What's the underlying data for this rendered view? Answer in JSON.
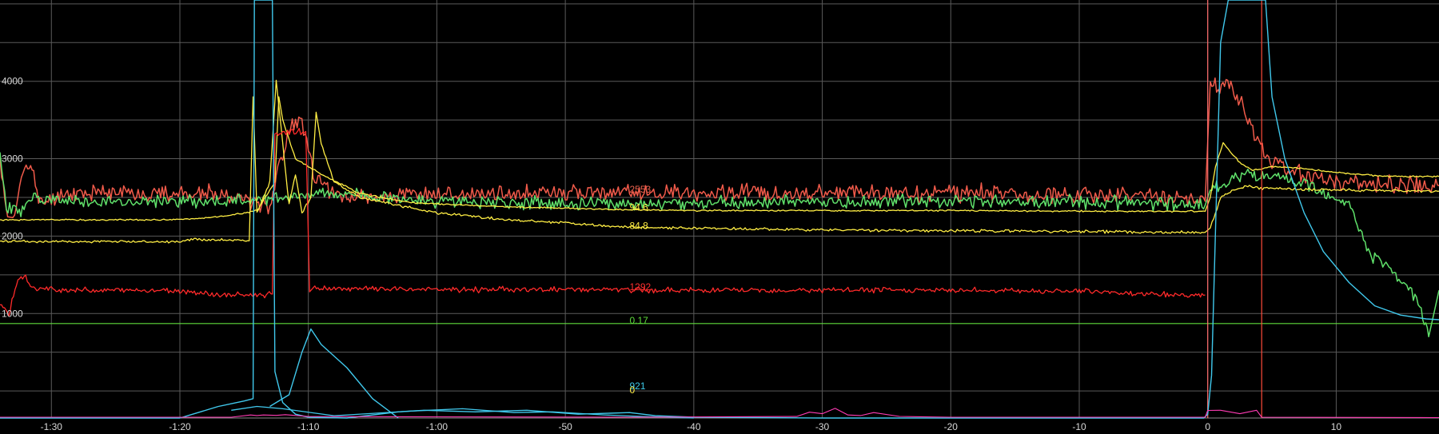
{
  "chart_data": {
    "type": "line",
    "title": "",
    "xlabel": "",
    "ylabel": "",
    "grid": true,
    "background": "#000000",
    "grid_color": "#5a5a5a",
    "xlim": [
      -94,
      18
    ],
    "ylim": [
      -350,
      5050
    ],
    "x_ticks": [
      {
        "value": -90,
        "label": "-1:30"
      },
      {
        "value": -80,
        "label": "-1:20"
      },
      {
        "value": -70,
        "label": "-1:10"
      },
      {
        "value": -60,
        "label": "-1:00"
      },
      {
        "value": -50,
        "label": "-50"
      },
      {
        "value": -40,
        "label": "-40"
      },
      {
        "value": -30,
        "label": "-30"
      },
      {
        "value": -20,
        "label": "-20"
      },
      {
        "value": -10,
        "label": "-10"
      },
      {
        "value": 0,
        "label": "0"
      },
      {
        "value": 10,
        "label": "10"
      }
    ],
    "y_ticks": [
      {
        "value": 1000,
        "label": "1000"
      },
      {
        "value": 2000,
        "label": "2000"
      },
      {
        "value": 3000,
        "label": "3000"
      },
      {
        "value": 4000,
        "label": "4000"
      }
    ],
    "cursor": {
      "x": -45,
      "labels": [
        {
          "text": "2553",
          "color": "#e8604c",
          "y": 2560
        },
        {
          "text": "94.6",
          "color": "#ffee44",
          "y": 2330
        },
        {
          "text": "84.8",
          "color": "#ffee44",
          "y": 2090
        },
        {
          "text": "1292",
          "color": "#ff3030",
          "y": 1300
        },
        {
          "text": "0.17",
          "color": "#5fdc3c",
          "y": 870
        },
        {
          "text": "921",
          "color": "#3cc8e8",
          "y": 20
        },
        {
          "text": "0",
          "color": "#ffee44",
          "y": -30
        }
      ]
    },
    "series": [
      {
        "color": "#f05a4a",
        "jitter": 90,
        "width": 1.5,
        "seed": 11,
        "points": [
          [
            -94,
            2950
          ],
          [
            -93.4,
            2250
          ],
          [
            -93,
            2150
          ],
          [
            -92.2,
            2850
          ],
          [
            -91.5,
            2950
          ],
          [
            -91,
            2400
          ],
          [
            -89,
            2560
          ],
          [
            -82,
            2560
          ],
          [
            -77,
            2540
          ],
          [
            -74,
            2450
          ],
          [
            -73,
            2400
          ],
          [
            -71.5,
            3400
          ],
          [
            -70.5,
            3500
          ],
          [
            -69.5,
            2700
          ],
          [
            -67,
            2500
          ],
          [
            -60,
            2540
          ],
          [
            -50,
            2560
          ],
          [
            -40,
            2560
          ],
          [
            -30,
            2560
          ],
          [
            -20,
            2560
          ],
          [
            -10,
            2540
          ],
          [
            -4,
            2500
          ],
          [
            -0.2,
            2450
          ],
          [
            0.2,
            3950
          ],
          [
            1.8,
            3950
          ],
          [
            3,
            3600
          ],
          [
            4,
            3200
          ],
          [
            5,
            3000
          ],
          [
            7,
            2800
          ],
          [
            10,
            2700
          ],
          [
            18,
            2650
          ]
        ]
      },
      {
        "color": "#5fe06a",
        "jitter": 70,
        "width": 1.5,
        "seed": 23,
        "points": [
          [
            -94,
            3000
          ],
          [
            -93.5,
            2400
          ],
          [
            -92.5,
            2300
          ],
          [
            -91.5,
            2500
          ],
          [
            -90,
            2450
          ],
          [
            -82,
            2450
          ],
          [
            -77,
            2450
          ],
          [
            -72,
            2500
          ],
          [
            -70,
            2550
          ],
          [
            -67,
            2550
          ],
          [
            -60,
            2450
          ],
          [
            -50,
            2420
          ],
          [
            -40,
            2420
          ],
          [
            -30,
            2450
          ],
          [
            -20,
            2460
          ],
          [
            -10,
            2450
          ],
          [
            -4,
            2420
          ],
          [
            -0.2,
            2400
          ],
          [
            0.2,
            2600
          ],
          [
            3,
            2800
          ],
          [
            5,
            2750
          ],
          [
            8,
            2650
          ],
          [
            11,
            2400
          ],
          [
            12.5,
            1800
          ],
          [
            14,
            1600
          ],
          [
            15.5,
            1350
          ],
          [
            16.5,
            1100
          ],
          [
            17.2,
            700
          ],
          [
            17.6,
            1000
          ],
          [
            18,
            1300
          ]
        ]
      },
      {
        "color": "#ffee44",
        "jitter": 8,
        "width": 1.3,
        "seed": 31,
        "points": [
          [
            -94,
            2210
          ],
          [
            -90,
            2210
          ],
          [
            -82,
            2210
          ],
          [
            -79,
            2220
          ],
          [
            -76,
            2270
          ],
          [
            -74,
            2330
          ],
          [
            -72.6,
            2700
          ],
          [
            -72.3,
            3800
          ],
          [
            -72,
            3500
          ],
          [
            -71,
            3000
          ],
          [
            -69,
            2800
          ],
          [
            -66,
            2550
          ],
          [
            -62,
            2430
          ],
          [
            -55,
            2380
          ],
          [
            -50,
            2360
          ],
          [
            -45,
            2340
          ],
          [
            -40,
            2330
          ],
          [
            -20,
            2330
          ],
          [
            -5,
            2320
          ],
          [
            -0.2,
            2320
          ],
          [
            0.2,
            2500
          ],
          [
            0.6,
            2900
          ],
          [
            1.2,
            3200
          ],
          [
            2.5,
            2950
          ],
          [
            3.5,
            2850
          ],
          [
            5,
            2900
          ],
          [
            7,
            2880
          ],
          [
            10,
            2820
          ],
          [
            14,
            2770
          ],
          [
            18,
            2770
          ]
        ]
      },
      {
        "color": "#ffee44",
        "jitter": 14,
        "width": 1.3,
        "seed": 37,
        "points": [
          [
            -94,
            1930
          ],
          [
            -86,
            1930
          ],
          [
            -80,
            1930
          ],
          [
            -79,
            1960
          ],
          [
            -76,
            1950
          ],
          [
            -74.6,
            1940
          ],
          [
            -74.3,
            3800
          ],
          [
            -74,
            2300
          ],
          [
            -73,
            2700
          ],
          [
            -72.5,
            4000
          ],
          [
            -72,
            3200
          ],
          [
            -71.5,
            2400
          ],
          [
            -71,
            2800
          ],
          [
            -70.5,
            2300
          ],
          [
            -69.8,
            2500
          ],
          [
            -69.4,
            3600
          ],
          [
            -69,
            3200
          ],
          [
            -68,
            2700
          ],
          [
            -66,
            2500
          ],
          [
            -60,
            2300
          ],
          [
            -55,
            2220
          ],
          [
            -50,
            2170
          ],
          [
            -45,
            2110
          ],
          [
            -40,
            2100
          ],
          [
            -30,
            2080
          ],
          [
            -20,
            2070
          ],
          [
            -10,
            2060
          ],
          [
            -4,
            2050
          ],
          [
            -0.2,
            2050
          ],
          [
            0.2,
            2100
          ],
          [
            1,
            2500
          ],
          [
            2,
            2600
          ],
          [
            3,
            2650
          ],
          [
            4,
            2620
          ],
          [
            8,
            2600
          ],
          [
            18,
            2580
          ]
        ]
      },
      {
        "color": "#ff2a2a",
        "jitter": 30,
        "width": 1.3,
        "seed": 43,
        "points": [
          [
            -94,
            1100
          ],
          [
            -93.3,
            1000
          ],
          [
            -92.6,
            1450
          ],
          [
            -92,
            1470
          ],
          [
            -91.5,
            1330
          ],
          [
            -90,
            1310
          ],
          [
            -85,
            1300
          ],
          [
            -80,
            1300
          ],
          [
            -77,
            1240
          ],
          [
            -74,
            1240
          ],
          [
            -72.8,
            1250
          ],
          [
            -72.6,
            3300
          ],
          [
            -72,
            3350
          ],
          [
            -70.2,
            3350
          ],
          [
            -69.9,
            1280
          ],
          [
            -69.5,
            1320
          ],
          [
            -60,
            1310
          ],
          [
            -50,
            1310
          ],
          [
            -40,
            1300
          ],
          [
            -30,
            1300
          ],
          [
            -20,
            1300
          ],
          [
            -10,
            1290
          ],
          [
            -5,
            1250
          ],
          [
            -0.2,
            1240
          ]
        ]
      },
      {
        "color": "#5fdc3c",
        "jitter": 0,
        "width": 1.2,
        "seed": 0,
        "points": [
          [
            -94,
            870
          ],
          [
            18,
            870
          ]
        ]
      },
      {
        "color": "#ff6b6b",
        "jitter": 0,
        "width": 1.2,
        "seed": 0,
        "points": [
          [
            0,
            -350
          ],
          [
            0,
            5050
          ]
        ]
      },
      {
        "color": "#ff4a3a",
        "jitter": 0,
        "width": 1.2,
        "seed": 0,
        "points": [
          [
            4.2,
            -350
          ],
          [
            4.2,
            5050
          ]
        ]
      },
      {
        "color": "#40c8ec",
        "jitter": 0,
        "width": 1.4,
        "seed": 0,
        "points": [
          [
            -94,
            -350
          ],
          [
            -80,
            -350
          ],
          [
            -79,
            -300
          ],
          [
            -77,
            -200
          ],
          [
            -75,
            -130
          ],
          [
            -74.3,
            -100
          ],
          [
            -74.2,
            5050
          ],
          [
            -72.8,
            5050
          ],
          [
            -72.6,
            250
          ],
          [
            -72,
            -150
          ],
          [
            -71,
            -300
          ],
          [
            -70,
            -340
          ],
          [
            -67,
            -350
          ],
          [
            -63,
            -270
          ],
          [
            -61,
            -250
          ],
          [
            -57,
            -270
          ],
          [
            -53,
            -250
          ],
          [
            -49,
            -300
          ],
          [
            -45,
            -280
          ],
          [
            -43,
            -320
          ],
          [
            -40,
            -340
          ],
          [
            -30,
            -350
          ],
          [
            -0.3,
            -350
          ],
          [
            0,
            -300
          ],
          [
            0.3,
            200
          ],
          [
            1,
            4500
          ],
          [
            1.6,
            5050
          ],
          [
            4.5,
            5050
          ],
          [
            5,
            3800
          ],
          [
            6,
            3000
          ],
          [
            7.5,
            2300
          ],
          [
            9,
            1800
          ],
          [
            11,
            1400
          ],
          [
            13,
            1100
          ],
          [
            15,
            980
          ],
          [
            17,
            930
          ],
          [
            18,
            920
          ]
        ]
      },
      {
        "color": "#40c8ec",
        "jitter": 0,
        "width": 1.4,
        "seed": 0,
        "points": [
          [
            -73,
            -200
          ],
          [
            -71.5,
            -50
          ],
          [
            -70.5,
            500
          ],
          [
            -69.8,
            800
          ],
          [
            -69,
            600
          ],
          [
            -67,
            300
          ],
          [
            -65,
            -100
          ],
          [
            -63,
            -350
          ]
        ]
      },
      {
        "color": "#40c8ec",
        "jitter": 0,
        "width": 1.3,
        "seed": 0,
        "points": [
          [
            -76,
            -250
          ],
          [
            -74,
            -200
          ],
          [
            -72,
            -230
          ],
          [
            -68,
            -320
          ],
          [
            -62,
            -260
          ],
          [
            -58,
            -230
          ],
          [
            -54,
            -280
          ],
          [
            -51,
            -270
          ],
          [
            -47,
            -310
          ],
          [
            -44,
            -330
          ],
          [
            -40,
            -350
          ]
        ]
      },
      {
        "color": "#ff3cb4",
        "jitter": 0,
        "width": 1.1,
        "seed": 0,
        "spikes": true,
        "points": [
          [
            -94,
            -340
          ],
          [
            -76,
            -340
          ],
          [
            -74.5,
            -300
          ],
          [
            -74,
            -100
          ],
          [
            -73.5,
            -250
          ],
          [
            -72.5,
            -200
          ],
          [
            -71.8,
            -300
          ],
          [
            -70,
            -330
          ],
          [
            -60,
            -335
          ],
          [
            -45,
            -340
          ],
          [
            -32,
            -330
          ],
          [
            -31,
            -250
          ],
          [
            -30,
            -100
          ],
          [
            -29,
            -150
          ],
          [
            -28,
            -250
          ],
          [
            -27,
            -230
          ],
          [
            -26,
            -270
          ],
          [
            -24,
            -320
          ],
          [
            -20,
            -340
          ],
          [
            -0.2,
            -340
          ],
          [
            0,
            -200
          ],
          [
            1,
            -250
          ],
          [
            2.5,
            -280
          ],
          [
            3.8,
            -250
          ],
          [
            4.2,
            -340
          ],
          [
            18,
            -345
          ]
        ]
      }
    ]
  }
}
